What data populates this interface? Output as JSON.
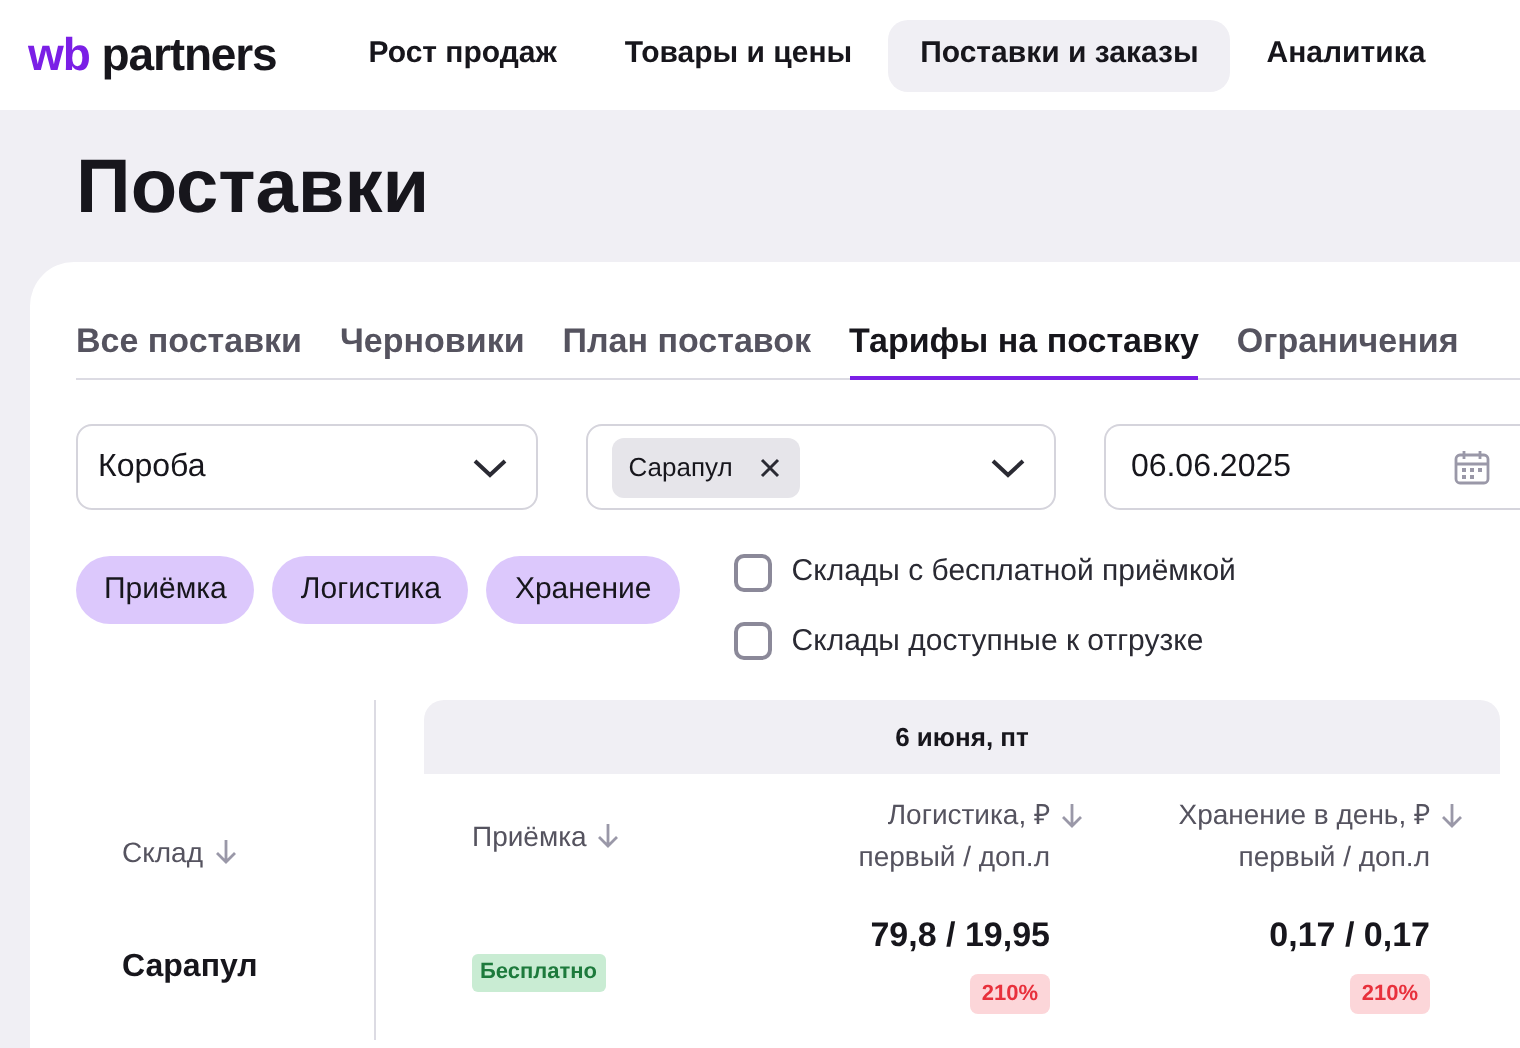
{
  "header": {
    "logo_prefix": "wb",
    "logo_text": "partners",
    "nav": [
      {
        "label": "Рост продаж",
        "selected": false
      },
      {
        "label": "Товары и цены",
        "selected": false
      },
      {
        "label": "Поставки и заказы",
        "selected": true
      },
      {
        "label": "Аналитика",
        "selected": false
      }
    ]
  },
  "page_title": "Поставки",
  "tabs": [
    {
      "label": "Все поставки",
      "selected": false
    },
    {
      "label": "Черновики",
      "selected": false
    },
    {
      "label": "План поставок",
      "selected": false
    },
    {
      "label": "Тарифы на поставку",
      "selected": true
    },
    {
      "label": "Ограничения",
      "selected": false
    }
  ],
  "filters": {
    "box_type": {
      "value": "Короба"
    },
    "warehouse": {
      "tags": [
        "Сарапул"
      ]
    },
    "date": {
      "value": "06.06.2025"
    }
  },
  "chips": [
    {
      "label": "Приёмка",
      "selected": true
    },
    {
      "label": "Логистика",
      "selected": true
    },
    {
      "label": "Хранение",
      "selected": true
    }
  ],
  "checkboxes": [
    {
      "label": "Склады с бесплатной приёмкой",
      "checked": false
    },
    {
      "label": "Склады доступные к отгрузке",
      "checked": false
    }
  ],
  "table": {
    "date_header": "6 июня, пт",
    "columns": [
      {
        "label": "Склад"
      },
      {
        "label": "Приёмка"
      },
      {
        "label": "Логистика, ₽",
        "sublabel": "первый / доп.л"
      },
      {
        "label": "Хранение в день, ₽",
        "sublabel": "первый / доп.л"
      }
    ],
    "rows": [
      {
        "warehouse": "Сарапул",
        "acceptance": "Бесплатно",
        "logistics": "79,8 / 19,95",
        "logistics_coef": "210%",
        "storage": "0,17 / 0,17",
        "storage_coef": "210%"
      }
    ]
  }
}
